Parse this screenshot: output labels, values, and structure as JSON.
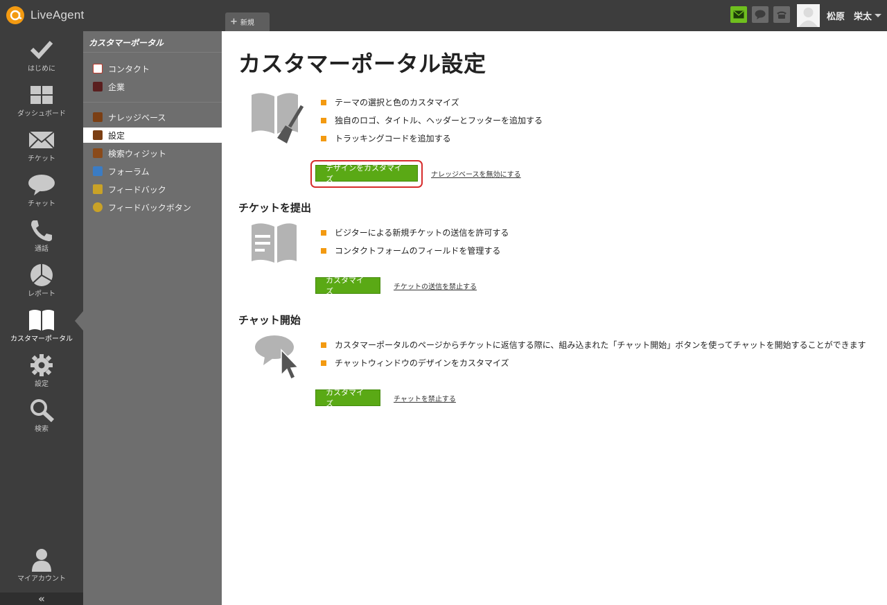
{
  "app": {
    "brand": "LiveAgent",
    "new_tab_label": "新規",
    "user_name": "松原　栄太"
  },
  "colors": {
    "accent_orange": "#f39a11",
    "button_green": "#5aa915",
    "highlight_red": "#d62b2b"
  },
  "nav": {
    "items": [
      {
        "label": "はじめに",
        "icon": "checkmark-icon"
      },
      {
        "label": "ダッシュボード",
        "icon": "dashboard-icon"
      },
      {
        "label": "チケット",
        "icon": "envelope-icon"
      },
      {
        "label": "チャット",
        "icon": "chat-bubble-icon"
      },
      {
        "label": "通話",
        "icon": "phone-icon"
      },
      {
        "label": "レポート",
        "icon": "pie-chart-icon"
      },
      {
        "label": "カスタマーポータル",
        "icon": "book-icon"
      },
      {
        "label": "設定",
        "icon": "gear-icon"
      },
      {
        "label": "検索",
        "icon": "magnifier-icon"
      }
    ],
    "my_account": "マイアカウント",
    "collapse": "«"
  },
  "subnav": {
    "title": "カスタマーポータル",
    "items": [
      {
        "label": "コンタクト"
      },
      {
        "label": "企業"
      },
      {
        "label": "ナレッジベース"
      },
      {
        "label": "設定"
      },
      {
        "label": "検索ウィジット"
      },
      {
        "label": "フォーラム"
      },
      {
        "label": "フィードバック"
      },
      {
        "label": "フィードバックボタン"
      }
    ]
  },
  "main": {
    "title": "カスタマーポータル設定",
    "kb_section": {
      "bullets": [
        "テーマの選択と色のカスタマイズ",
        "独自のロゴ、タイトル、ヘッダーとフッターを追加する",
        "トラッキングコードを追加する"
      ],
      "button": "デザインをカスタマイズ",
      "link": "ナレッジベースを無効にする"
    },
    "ticket_section": {
      "title": "チケットを提出",
      "bullets": [
        "ビジターによる新規チケットの送信を許可する",
        "コンタクトフォームのフィールドを管理する"
      ],
      "button": "カスタマイズ",
      "link": "チケットの送信を禁止する"
    },
    "chat_section": {
      "title": "チャット開始",
      "bullets": [
        "カスタマーポータルのページからチケットに返信する際に、組み込まれた「チャット開始」ボタンを使ってチャットを開始することができます",
        "チャットウィンドウのデザインをカスタマイズ"
      ],
      "button": "カスタマイズ",
      "link": "チャットを禁止する"
    }
  }
}
